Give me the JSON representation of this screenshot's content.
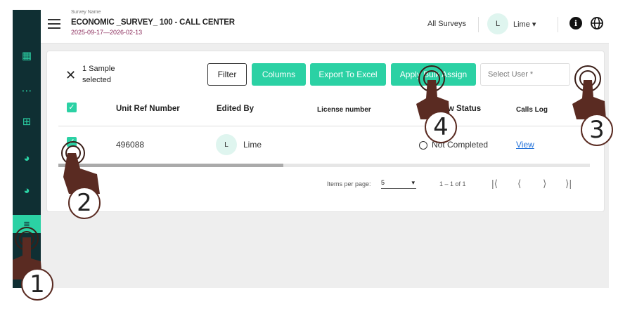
{
  "header": {
    "survey_label": "Survey Name",
    "survey_title": "ECONOMIC _SURVEY_ 100 - CALL CENTER",
    "survey_dates": "2025-09-17—2026-02-13",
    "all_surveys": "All Surveys",
    "user_initial": "L",
    "user_name": "Lime ▾",
    "info": "i"
  },
  "toolbar": {
    "selected_count": "1 Sample selected",
    "filter": "Filter",
    "columns": "Columns",
    "export": "Export To Excel",
    "apply_bulk": "Apply Bulk Assign",
    "select_user_placeholder": "Select User *"
  },
  "table": {
    "columns": [
      "Unit Ref Number",
      "Edited By",
      "License number",
      "Interview Status",
      "Calls Log"
    ],
    "rows": [
      {
        "unit_ref": "496088",
        "editor_initial": "L",
        "editor": "Lime",
        "license": "",
        "status": "Not Completed",
        "calls_log": "View"
      }
    ]
  },
  "pagination": {
    "items_per_page_label": "Items per page:",
    "items_per_page": "5",
    "range": "1 – 1 of 1"
  },
  "steps": [
    "1",
    "2",
    "3",
    "4"
  ],
  "colors": {
    "accent": "#2bd1a4",
    "sidebar": "#0f2f33",
    "date": "#8a2a5a",
    "hand": "#5a2b22"
  }
}
